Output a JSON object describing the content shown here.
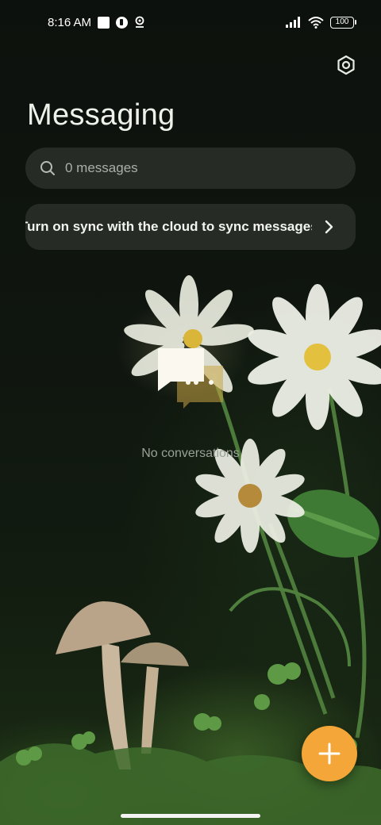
{
  "status_bar": {
    "time": "8:16 AM",
    "battery": "100",
    "icons": [
      "notification-square-icon",
      "app-notification-icon",
      "location-icon",
      "signal-icon",
      "wifi-icon",
      "battery-icon"
    ]
  },
  "header": {
    "title": "Messaging",
    "settings_icon": "settings-icon"
  },
  "search": {
    "placeholder": "0 messages",
    "value": "",
    "icon": "search-icon"
  },
  "sync_banner": {
    "text": "Turn on sync with the cloud to sync messages",
    "icon": "chevron-right-icon"
  },
  "empty_state": {
    "icon": "chat-bubbles-icon",
    "text": "No conversations"
  },
  "fab": {
    "icon": "plus-icon",
    "color": "#f4a638"
  },
  "colors": {
    "accent": "#f4a638",
    "background": "#0d110d"
  }
}
